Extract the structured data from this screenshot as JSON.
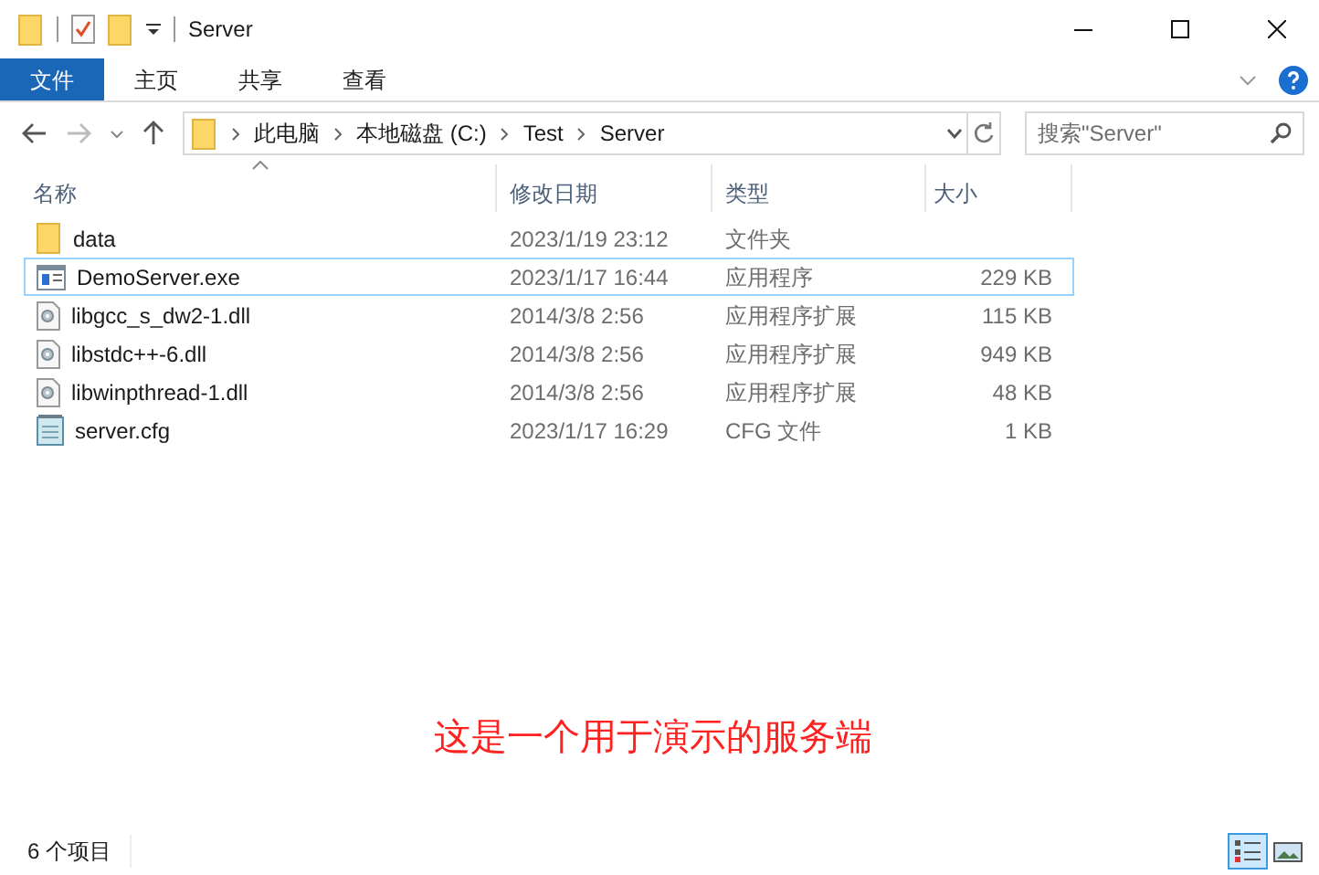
{
  "window": {
    "title": "Server"
  },
  "ribbon_tabs": [
    {
      "label": "文件",
      "selected": true
    },
    {
      "label": "主页",
      "selected": false
    },
    {
      "label": "共享",
      "selected": false
    },
    {
      "label": "查看",
      "selected": false
    }
  ],
  "address_bar": {
    "crumbs": [
      "此电脑",
      "本地磁盘 (C:)",
      "Test",
      "Server"
    ]
  },
  "search": {
    "placeholder": "搜索\"Server\""
  },
  "table": {
    "columns": [
      "名称",
      "修改日期",
      "类型",
      "大小"
    ],
    "rows": [
      {
        "kind": "folder",
        "name": "data",
        "date": "2023/1/19 23:12",
        "type": "文件夹",
        "selected": false
      },
      {
        "kind": "exe",
        "name": "DemoServer.exe",
        "date": "2023/1/17 16:44",
        "type": "应用程序",
        "size": "229 KB",
        "selected": true
      },
      {
        "kind": "dll",
        "name": "libgcc_s_dw2-1.dll",
        "date": "2014/3/8 2:56",
        "type": "应用程序扩展",
        "size": "115 KB",
        "selected": false
      },
      {
        "kind": "dll",
        "name": "libstdc++-6.dll",
        "date": "2014/3/8 2:56",
        "type": "应用程序扩展",
        "size": "949 KB",
        "selected": false
      },
      {
        "kind": "dll",
        "name": "libwinpthread-1.dll",
        "date": "2014/3/8 2:56",
        "type": "应用程序扩展",
        "size": "48 KB",
        "selected": false
      },
      {
        "kind": "cfg",
        "name": "server.cfg",
        "date": "2023/1/17 16:29",
        "type": "CFG 文件",
        "size": "1 KB",
        "selected": false
      }
    ]
  },
  "caption": "这是一个用于演示的服务端",
  "status_bar": {
    "item_count": "6 个项目",
    "views": [
      {
        "kind": "details",
        "selected": true
      },
      {
        "kind": "large",
        "selected": false
      }
    ]
  }
}
